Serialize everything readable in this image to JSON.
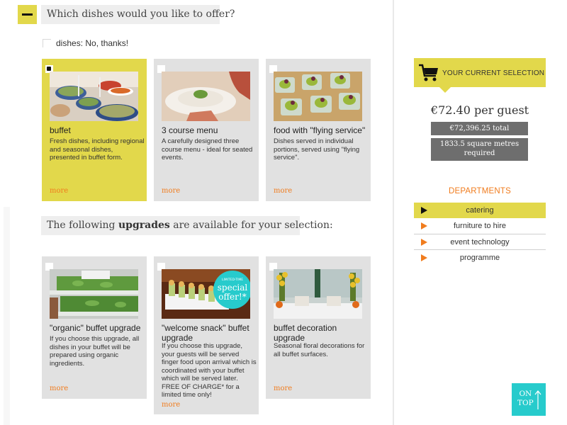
{
  "dishes_section": {
    "title": "Which dishes would you like to offer?",
    "opt_out_label": "dishes: No, thanks!",
    "cards": [
      {
        "title": "buffet",
        "description": "Fresh dishes, including regional and seasonal dishes, presented in buffet form.",
        "more": "more",
        "selected": true,
        "image": "buffet-photo"
      },
      {
        "title": "3 course menu",
        "description": "A carefully designed three course menu - ideal for seated events.",
        "more": "more",
        "selected": false,
        "image": "plated-dish-photo"
      },
      {
        "title": "food with \"flying service\"",
        "description": "Dishes served in individual portions, served using \"flying service\".",
        "more": "more",
        "selected": false,
        "image": "glass-bowls-photo"
      }
    ]
  },
  "upgrades_section": {
    "title_pre": "The following ",
    "title_bold": "upgrades",
    "title_post": " are available for your selection:",
    "cards": [
      {
        "title": "\"organic\" buffet upgrade",
        "description": "If you choose this upgrade, all dishes in your buffet will be prepared using organic ingredients.",
        "more": "more",
        "selected": false,
        "image": "organic-greens-photo"
      },
      {
        "title": "\"welcome snack\" buffet upgrade",
        "description": "If you choose this upgrade, your guests will be served finger food upon arrival which is coordinated with your buffet which will be served later. FREE OF CHARGE* for a limited time only!",
        "more": "more",
        "selected": false,
        "image": "finger-food-photo",
        "badge": {
          "line1": "LIMITED-TIME",
          "line2": "special",
          "line3": "offer!*"
        }
      },
      {
        "title": "buffet decoration upgrade",
        "description": "Seasonal floral decorations for all buffet surfaces.",
        "more": "more",
        "selected": false,
        "image": "floral-decoration-photo"
      }
    ]
  },
  "selection": {
    "label": "YOUR CURRENT SELECTION",
    "price_per_guest": "€72.40 per guest",
    "total": "€72,396.25 total",
    "area": "1833.5 square metres required"
  },
  "departments": {
    "title": "DEPARTMENTS",
    "items": [
      {
        "label": "catering",
        "active": true
      },
      {
        "label": "furniture to hire",
        "active": false
      },
      {
        "label": "event technology",
        "active": false
      },
      {
        "label": "programme",
        "active": false
      }
    ]
  },
  "on_top": {
    "line1": "ON",
    "line2": "TOP"
  },
  "colors": {
    "accent_yellow": "#e2d84b",
    "link_orange": "#f07c1e",
    "card_gray": "#e1e1e1",
    "teal": "#27cbcc",
    "summary_gray": "#6e6e6e"
  }
}
